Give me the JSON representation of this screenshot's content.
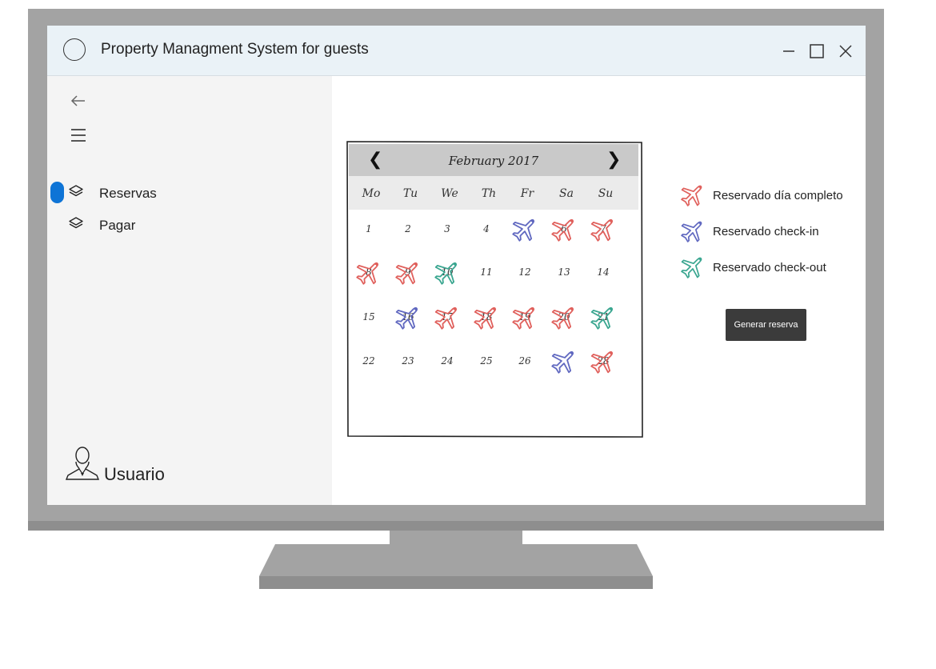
{
  "window": {
    "title": "Property Managment System for guests",
    "controls": [
      "minimize-icon",
      "maximize-icon",
      "close-icon"
    ]
  },
  "sidebar": {
    "items": [
      {
        "label": "Reservas",
        "icon": "layers-icon",
        "selected": true
      },
      {
        "label": "Pagar",
        "icon": "layers-icon",
        "selected": false
      }
    ],
    "user_label": "Usuario"
  },
  "calendar": {
    "month_title": "February 2017",
    "weekdays": [
      "Mo",
      "Tu",
      "We",
      "Th",
      "Fr",
      "Sa",
      "Su"
    ],
    "weeks": [
      [
        {
          "day": "1",
          "status": "none"
        },
        {
          "day": "2",
          "status": "none"
        },
        {
          "day": "3",
          "status": "none"
        },
        {
          "day": "4",
          "status": "none"
        },
        {
          "day": "",
          "status": "checkin"
        },
        {
          "day": "6",
          "status": "full"
        },
        {
          "day": "7",
          "status": "full"
        }
      ],
      [
        {
          "day": "8",
          "status": "full"
        },
        {
          "day": "9",
          "status": "full"
        },
        {
          "day": "10",
          "status": "checkout"
        },
        {
          "day": "11",
          "status": "none"
        },
        {
          "day": "12",
          "status": "none"
        },
        {
          "day": "13",
          "status": "none"
        },
        {
          "day": "14",
          "status": "none"
        }
      ],
      [
        {
          "day": "15",
          "status": "none"
        },
        {
          "day": "16",
          "status": "checkin"
        },
        {
          "day": "17",
          "status": "full"
        },
        {
          "day": "18",
          "status": "full"
        },
        {
          "day": "19",
          "status": "full"
        },
        {
          "day": "20",
          "status": "full"
        },
        {
          "day": "21",
          "status": "checkout"
        }
      ],
      [
        {
          "day": "22",
          "status": "none"
        },
        {
          "day": "23",
          "status": "none"
        },
        {
          "day": "24",
          "status": "none"
        },
        {
          "day": "25",
          "status": "none"
        },
        {
          "day": "26",
          "status": "none"
        },
        {
          "day": "",
          "status": "checkin"
        },
        {
          "day": "28",
          "status": "full"
        }
      ]
    ]
  },
  "legend": [
    {
      "label": "Reservado día completo",
      "status": "full",
      "color": "#e0605c"
    },
    {
      "label": "Reservado check-in",
      "status": "checkin",
      "color": "#6068c0"
    },
    {
      "label": "Reservado check-out",
      "status": "checkout",
      "color": "#3aa690"
    }
  ],
  "actions": {
    "generate_label": "Generar reserva"
  },
  "colors": {
    "accent": "#0e74d6",
    "titlebar": "#eaf2f7",
    "sidebar": "#f4f4f4",
    "bezel": "#a3a3a3",
    "button": "#3b3b3b"
  }
}
